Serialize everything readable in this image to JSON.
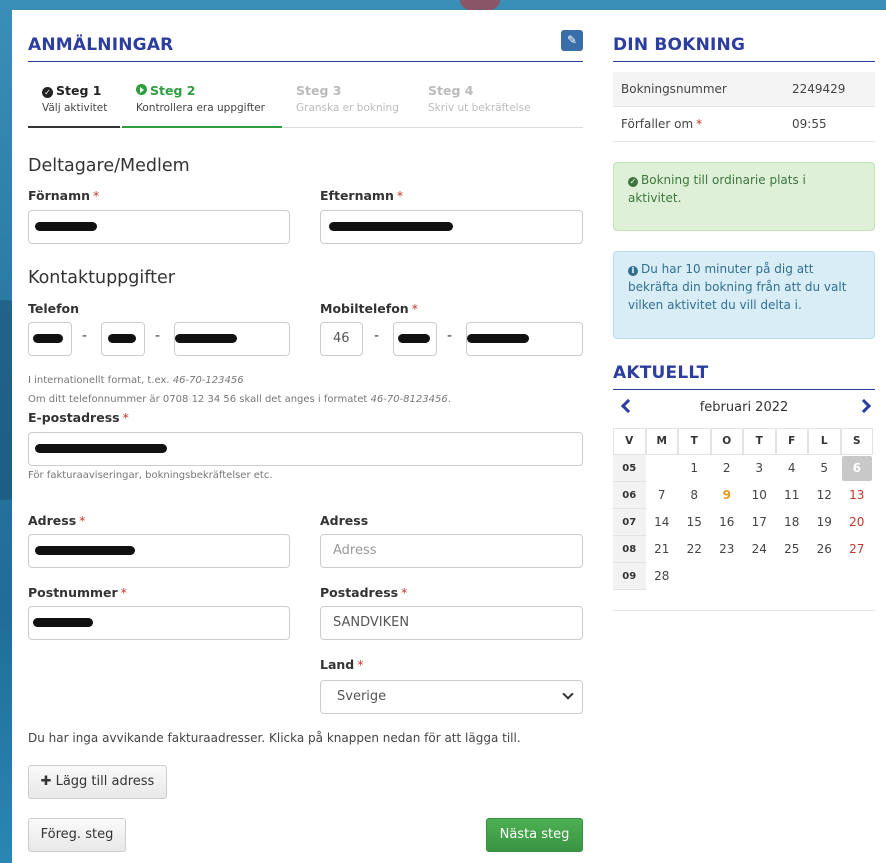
{
  "anmalningar": {
    "title": "ANMÄLNINGAR",
    "edit_icon": "pencil-icon",
    "steps": [
      {
        "name": "Steg 1",
        "sub": "Välj aktivitet",
        "icon": "check-circle-icon"
      },
      {
        "name": "Steg 2",
        "sub": "Kontrollera era uppgifter",
        "icon": "play-circle-icon"
      },
      {
        "name": "Steg 3",
        "sub": "Granska er bokning"
      },
      {
        "name": "Steg 4",
        "sub": "Skriv ut bekräftelse"
      }
    ]
  },
  "form": {
    "section_member": "Deltagare/Medlem",
    "firstname_label": "Förnamn",
    "lastname_label": "Efternamn",
    "section_contact": "Kontaktuppgifter",
    "phone_label": "Telefon",
    "mobile_label": "Mobiltelefon",
    "mobile_country": "46",
    "dash": "-",
    "help_intl_prefix": "I internationellt format, t.ex. ",
    "help_intl_example": "46-70-123456",
    "help_example_prefix": "Om ditt telefonnummer är 0708 12 34 56 skall det anges i formatet ",
    "help_example_value": "46-70-8123456",
    "help_example_suffix": ".",
    "email_label": "E-postadress",
    "email_help": "För fakturaaviseringar, bokningsbekräftelser etc.",
    "address_label": "Adress",
    "address2_label": "Adress",
    "address2_placeholder": "Adress",
    "zip_label": "Postnummer",
    "city_label": "Postadress",
    "city_value": "SANDVIKEN",
    "country_label": "Land",
    "country_value": "Sverige",
    "required_mark": "*",
    "invoice_note": "Du har inga avvikande fakturaadresser. Klicka på knappen nedan för att lägga till.",
    "add_address_button": "Lägg till adress",
    "prev_button": "Föreg. steg",
    "next_button": "Nästa steg"
  },
  "booking": {
    "title": "DIN BOKNING",
    "number_label": "Bokningsnummer",
    "number_value": "2249429",
    "expires_label": "Förfaller om",
    "expires_value": "09:55",
    "success_text": "Bokning till ordinarie plats i aktivitet.",
    "info_text": "Du har 10 minuter på dig att bekräfta din bokning från att du valt vilken aktivitet du vill delta i."
  },
  "news": {
    "title": "AKTUELLT",
    "month": "februari 2022",
    "weekday_headers": [
      "V",
      "M",
      "T",
      "O",
      "T",
      "F",
      "L",
      "S"
    ],
    "weeks": [
      {
        "week": "05",
        "days": [
          "",
          "1",
          "2",
          "3",
          "4",
          "5",
          "6"
        ]
      },
      {
        "week": "06",
        "days": [
          "7",
          "8",
          "9",
          "10",
          "11",
          "12",
          "13"
        ]
      },
      {
        "week": "07",
        "days": [
          "14",
          "15",
          "16",
          "17",
          "18",
          "19",
          "20"
        ]
      },
      {
        "week": "08",
        "days": [
          "21",
          "22",
          "23",
          "24",
          "25",
          "26",
          "27"
        ]
      },
      {
        "week": "09",
        "days": [
          "28",
          "",
          "",
          "",
          "",
          "",
          ""
        ]
      }
    ],
    "today": "6",
    "highlight_day": "9"
  },
  "colors": {
    "heading": "#2c3e9e",
    "active_step": "#2f9e3f",
    "success_bg": "#dff0d8",
    "info_bg": "#d9edf7",
    "sunday": "#c0392b"
  }
}
